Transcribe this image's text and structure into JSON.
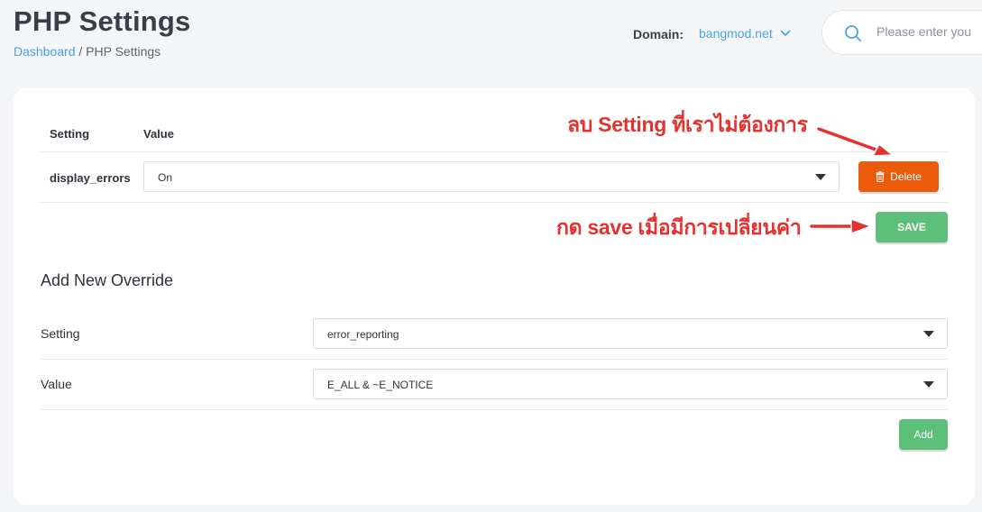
{
  "header": {
    "title": "PHP Settings",
    "breadcrumb": {
      "home": "Dashboard",
      "separator": " / ",
      "current": "PHP Settings"
    },
    "domain_label": "Domain:",
    "domain_value": "bangmod.net",
    "search_placeholder": "Please enter you"
  },
  "table": {
    "col_setting": "Setting",
    "col_value": "Value",
    "rows": [
      {
        "setting": "display_errors",
        "value": "On",
        "delete_label": "Delete"
      }
    ],
    "save_label": "SAVE"
  },
  "override": {
    "title": "Add New Override",
    "setting_label": "Setting",
    "setting_value": "error_reporting",
    "value_label": "Value",
    "value_value": "E_ALL & ~E_NOTICE",
    "add_label": "Add"
  },
  "annotations": {
    "delete_note": "ลบ Setting ที่เราไม่ต้องการ",
    "save_note": "กด save เมื่อมีการเปลี่ยนค่า"
  },
  "colors": {
    "accent_link": "#4aa3df",
    "delete_button": "#ea5b0c",
    "save_button": "#5cbf7a",
    "annotation": "#e5322e"
  },
  "icons": [
    "search-icon",
    "chevron-down-icon",
    "caret-down-icon",
    "trash-icon",
    "arrow-icon"
  ]
}
